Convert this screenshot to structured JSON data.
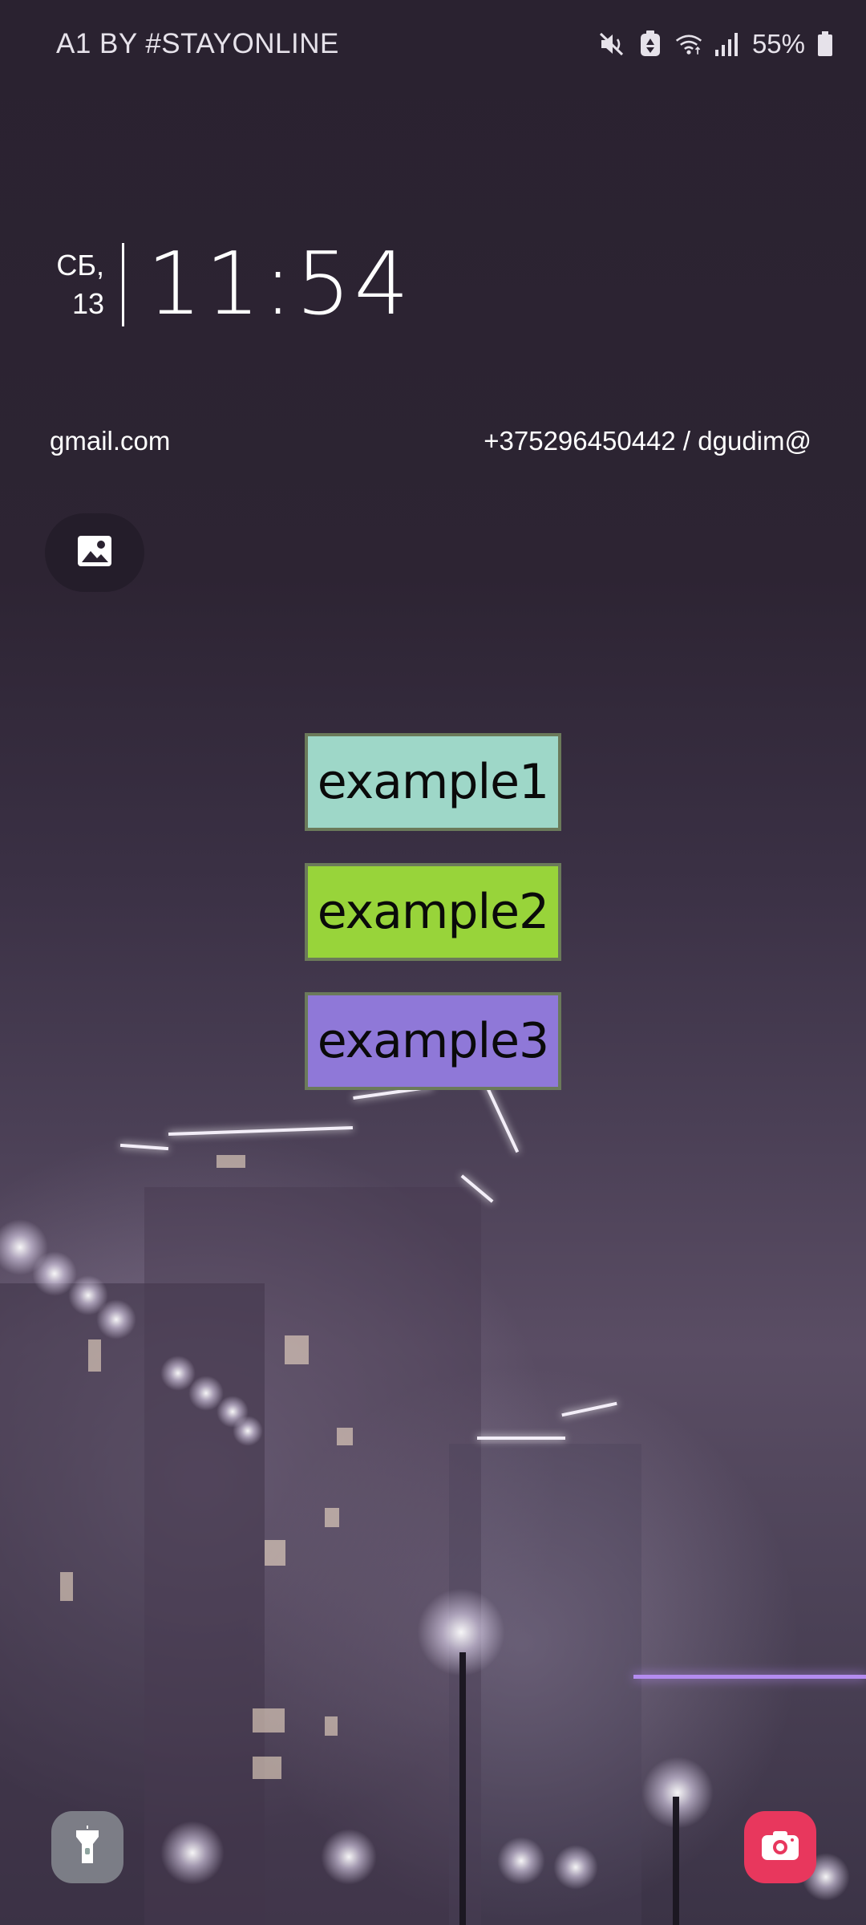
{
  "status_bar": {
    "carrier": "A1 BY #STAYONLINE",
    "battery_percent": "55%",
    "icons": [
      "mute-vibrate-icon",
      "battery-saver-icon",
      "wifi-icon",
      "signal-icon",
      "battery-icon"
    ]
  },
  "clock": {
    "day": "СБ,",
    "date": "13",
    "time": "11:54"
  },
  "owner_info": {
    "left_text": "gmail.com",
    "right_text": "+375296450442 / dgudim@"
  },
  "wallpaper_button": {
    "icon": "image-icon"
  },
  "widgets": {
    "example1": "example1",
    "example2": "example2",
    "example3": "example3"
  },
  "shortcuts": {
    "left": "flashlight-icon",
    "right": "camera-icon"
  },
  "colors": {
    "example1_bg": "#9ed7c8",
    "example2_bg": "#98d43a",
    "example3_bg": "#8f78d8",
    "camera_bg": "#e8375d"
  }
}
